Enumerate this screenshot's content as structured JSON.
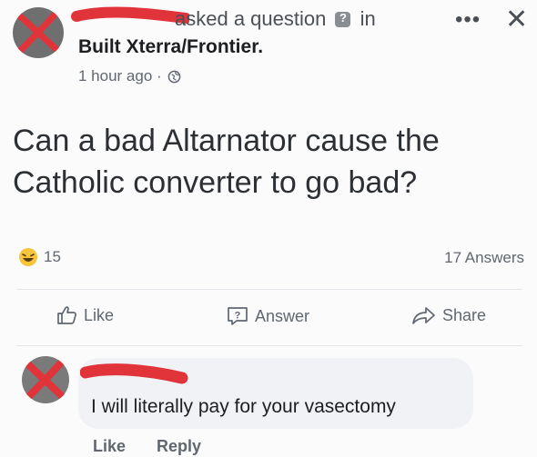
{
  "post": {
    "header_suffix": "asked a question",
    "header_in": "in",
    "group_name": "Built Xterra/Frontier.",
    "time": "1 hour ago ·",
    "question": "Can a bad Altarnator cause the Catholic converter to go bad?"
  },
  "stats": {
    "reactions": "15",
    "answers": "17 Answers"
  },
  "actions": {
    "like": "Like",
    "answer": "Answer",
    "share": "Share"
  },
  "comment": {
    "text": "I will literally pay for your vasectomy",
    "like": "Like",
    "reply": "Reply"
  },
  "colors": {
    "redaction": "#e0343a",
    "secondary_text": "#606770",
    "bubble": "#f0f2f5"
  },
  "icons": {
    "more": "more-icon",
    "close": "close-icon",
    "question_badge": "question-icon",
    "globe": "globe-icon",
    "reaction": "laughing-emoji-icon",
    "like": "thumbs-up-icon",
    "answer": "answer-bubble-icon",
    "share": "share-arrow-icon"
  }
}
